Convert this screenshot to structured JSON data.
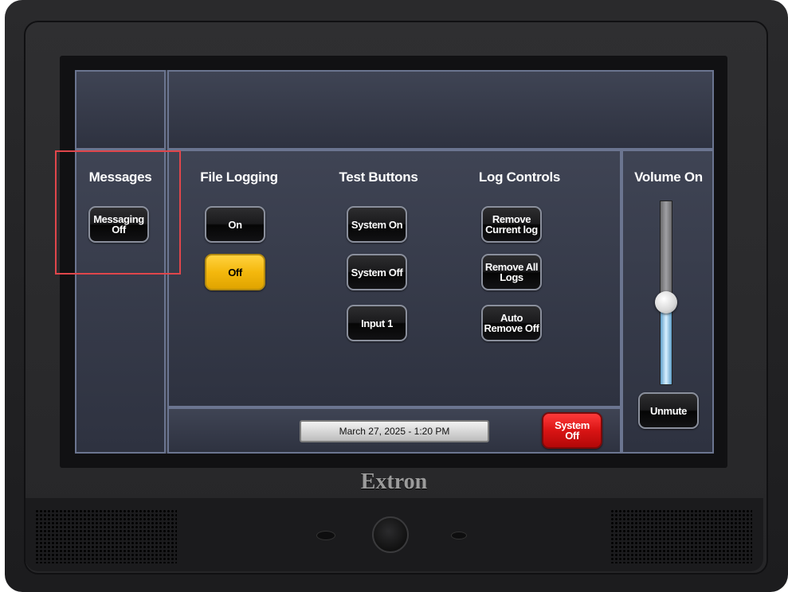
{
  "device": {
    "brand": "Extron"
  },
  "sections": {
    "messages": {
      "heading": "Messages",
      "button": [
        "Messaging",
        "Off"
      ]
    },
    "file_logging": {
      "heading": "File Logging",
      "on_label": "On",
      "off_label": "Off",
      "active": "Off"
    },
    "test_buttons": {
      "heading": "Test Buttons",
      "system_on": "System On",
      "system_off": "System Off",
      "input1": "Input 1"
    },
    "log_controls": {
      "heading": "Log Controls",
      "remove_current": [
        "Remove",
        "Current log"
      ],
      "remove_all": [
        "Remove All",
        "Logs"
      ],
      "auto_remove": [
        "Auto",
        "Remove Off"
      ]
    },
    "volume": {
      "heading": "Volume On",
      "level": 0.45,
      "unmute_label": "Unmute"
    }
  },
  "status_bar": {
    "datetime": "March 27, 2025  -  1:20 PM",
    "system_off": [
      "System",
      "Off"
    ]
  },
  "colors": {
    "active_yellow": "#f4b80d",
    "alert_red": "#d91414",
    "highlight": "#e0464b"
  }
}
